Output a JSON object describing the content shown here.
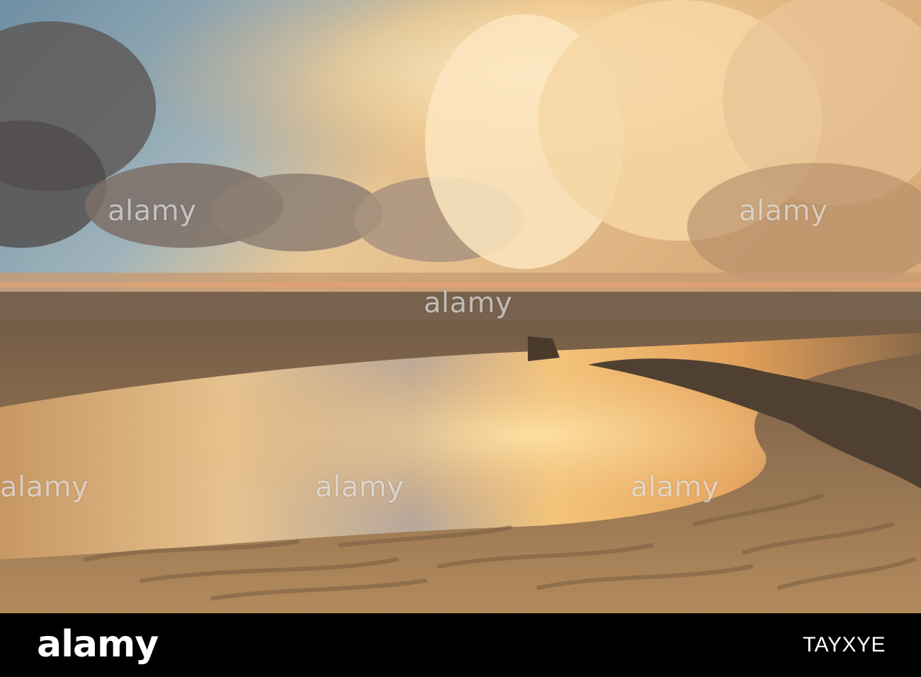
{
  "watermark": {
    "text": "alamy"
  },
  "footer": {
    "logo": "alamy",
    "image_id": "TAYXYE"
  },
  "colors": {
    "sky_blue": "#7f9fb3",
    "cloud_gold": "#f1c98b",
    "sand": "#a98458",
    "footer_bg": "#000000"
  }
}
